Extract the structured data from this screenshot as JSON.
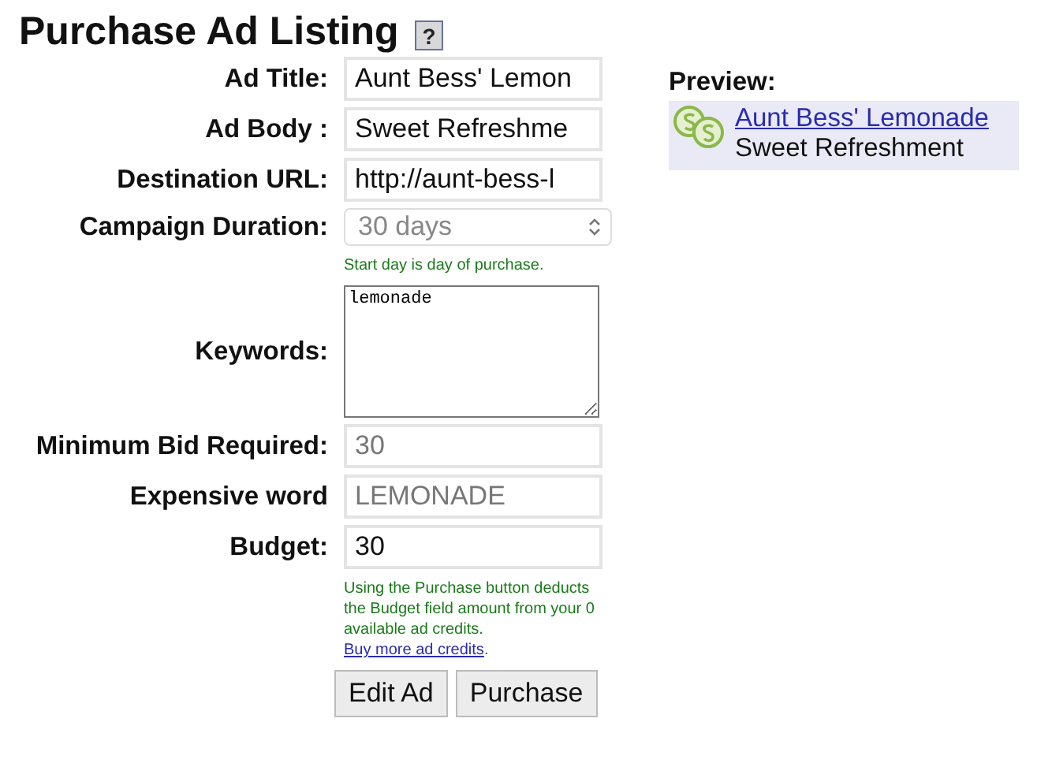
{
  "title": "Purchase Ad Listing",
  "help_button": "?",
  "fields": [
    {
      "kind": "text",
      "label": "Ad Title:",
      "value": "Aunt Bess' Lemon",
      "disabled": false
    },
    {
      "kind": "text",
      "label": "Ad Body :",
      "value": "Sweet Refreshme",
      "disabled": false
    },
    {
      "kind": "text",
      "label": "Destination URL:",
      "value": "http://aunt-bess-l",
      "disabled": false
    },
    {
      "kind": "select",
      "label": "Campaign Duration:",
      "value": "30 days",
      "disabled": true,
      "hint": "Start day is day of purchase."
    },
    {
      "kind": "textarea",
      "label": "Keywords:",
      "value": "lemonade"
    },
    {
      "kind": "text",
      "label": "Minimum Bid Required:",
      "value": "30",
      "disabled": true
    },
    {
      "kind": "text",
      "label": "Expensive word",
      "value": "LEMONADE",
      "disabled": true
    },
    {
      "kind": "text",
      "label": "Budget:",
      "value": "30",
      "disabled": false,
      "hint": "Using the Purchase button deducts the Budget field amount from your 0 available ad credits.",
      "link": "Buy more ad credits",
      "link_tail": "."
    }
  ],
  "buttons": [
    "Edit Ad",
    "Purchase"
  ],
  "preview": {
    "heading": "Preview:",
    "title": "Aunt Bess' Lemonade",
    "body": "Sweet Refreshment"
  }
}
